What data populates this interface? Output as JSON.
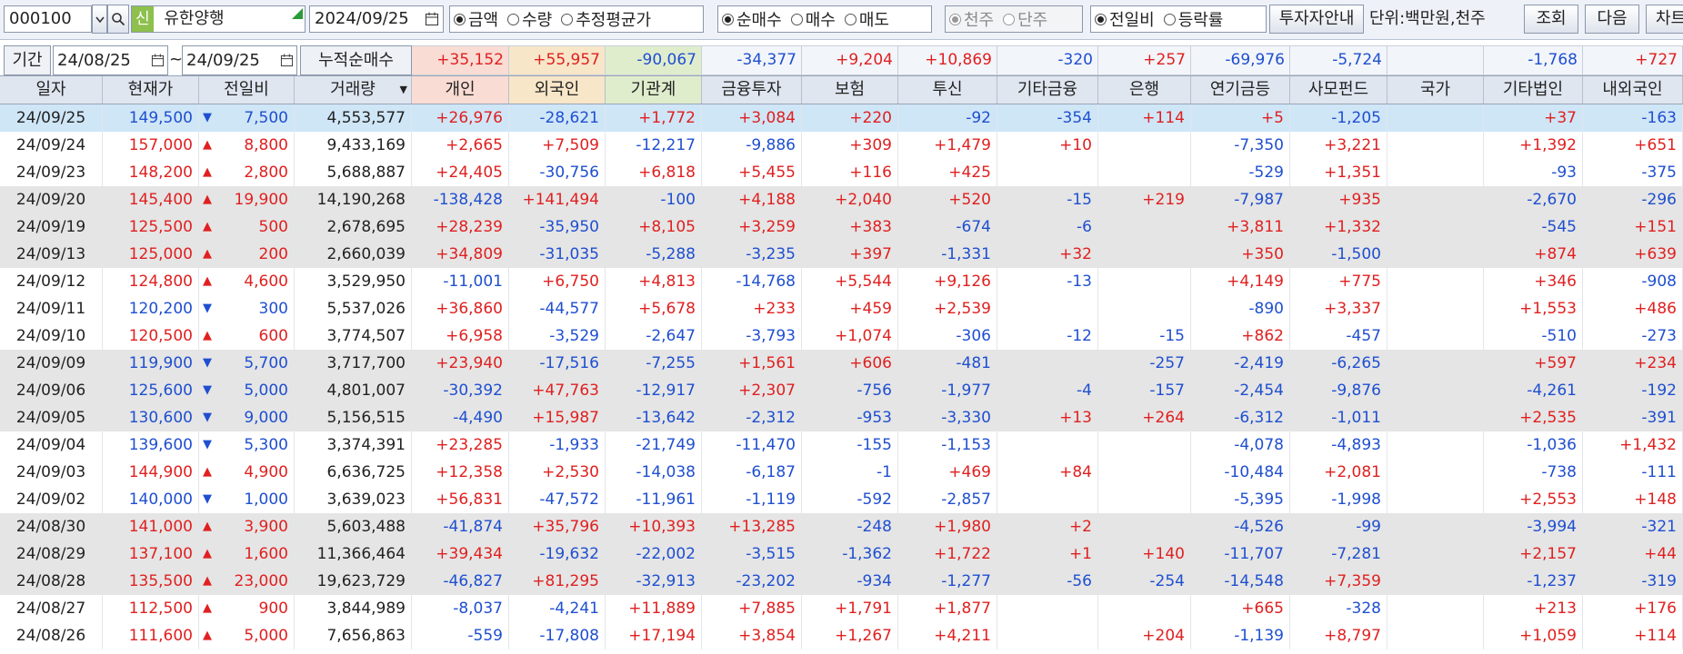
{
  "toolbar": {
    "code": "000100",
    "new_tag": "신",
    "stock_name": "유한양행",
    "date": "2024/09/25",
    "radio_value": [
      {
        "label": "금액",
        "checked": true
      },
      {
        "label": "수량",
        "checked": false
      },
      {
        "label": "추정평균가",
        "checked": false
      }
    ],
    "radio_type": [
      {
        "label": "순매수",
        "checked": true
      },
      {
        "label": "매수",
        "checked": false
      },
      {
        "label": "매도",
        "checked": false
      }
    ],
    "radio_unit": [
      {
        "label": "천주",
        "checked": true
      },
      {
        "label": "단주",
        "checked": false
      }
    ],
    "radio_compare": [
      {
        "label": "전일비",
        "checked": true
      },
      {
        "label": "등락률",
        "checked": false
      }
    ],
    "investor_guide_label": "투자자안내",
    "unit_text": "단위:백만원,천주",
    "query_label": "조회",
    "next_label": "다음",
    "chart_label": "차트"
  },
  "filter": {
    "period_label": "기간",
    "from_date": "24/08/25",
    "tilde": "~",
    "to_date": "24/09/25",
    "cumulative_label": "누적순매수",
    "sums": [
      "+35,152",
      "+55,957",
      "-90,067",
      "-34,377",
      "+9,204",
      "+10,869",
      "-320",
      "+257",
      "-69,976",
      "-5,724",
      "",
      "-1,768",
      "+727"
    ]
  },
  "columns": [
    "일자",
    "현재가",
    "전일비",
    "거래량",
    "개인",
    "외국인",
    "기관계",
    "금융투자",
    "보험",
    "투신",
    "기타금융",
    "은행",
    "연기금등",
    "사모펀드",
    "국가",
    "기타법인",
    "내외국인"
  ],
  "colors": {
    "up": "#e02020",
    "down": "#1f4fd0",
    "selected_row": "#cfe6f7",
    "shaded_row": "#e5e5e5",
    "personal_header": "#f9dcd3",
    "foreign_header": "#f7e6c8",
    "institution_header": "#e0edcd"
  },
  "rows": [
    [
      "24/09/25",
      "149,500",
      "▼",
      "7,500",
      "4,553,577",
      "+26,976",
      "-28,621",
      "+1,772",
      "+3,084",
      "+220",
      "-92",
      "-354",
      "+114",
      "+5",
      "-1,205",
      "",
      "+37",
      "-163"
    ],
    [
      "24/09/24",
      "157,000",
      "▲",
      "8,800",
      "9,433,169",
      "+2,665",
      "+7,509",
      "-12,217",
      "-9,886",
      "+309",
      "+1,479",
      "+10",
      "",
      "-7,350",
      "+3,221",
      "",
      "+1,392",
      "+651"
    ],
    [
      "24/09/23",
      "148,200",
      "▲",
      "2,800",
      "5,688,887",
      "+24,405",
      "-30,756",
      "+6,818",
      "+5,455",
      "+116",
      "+425",
      "",
      "",
      "-529",
      "+1,351",
      "",
      "-93",
      "-375"
    ],
    [
      "24/09/20",
      "145,400",
      "▲",
      "19,900",
      "14,190,268",
      "-138,428",
      "+141,494",
      "-100",
      "+4,188",
      "+2,040",
      "+520",
      "-15",
      "+219",
      "-7,987",
      "+935",
      "",
      "-2,670",
      "-296"
    ],
    [
      "24/09/19",
      "125,500",
      "▲",
      "500",
      "2,678,695",
      "+28,239",
      "-35,950",
      "+8,105",
      "+3,259",
      "+383",
      "-674",
      "-6",
      "",
      "+3,811",
      "+1,332",
      "",
      "-545",
      "+151"
    ],
    [
      "24/09/13",
      "125,000",
      "▲",
      "200",
      "2,660,039",
      "+34,809",
      "-31,035",
      "-5,288",
      "-3,235",
      "+397",
      "-1,331",
      "+32",
      "",
      "+350",
      "-1,500",
      "",
      "+874",
      "+639"
    ],
    [
      "24/09/12",
      "124,800",
      "▲",
      "4,600",
      "3,529,950",
      "-11,001",
      "+6,750",
      "+4,813",
      "-14,768",
      "+5,544",
      "+9,126",
      "-13",
      "",
      "+4,149",
      "+775",
      "",
      "+346",
      "-908"
    ],
    [
      "24/09/11",
      "120,200",
      "▼",
      "300",
      "5,537,026",
      "+36,860",
      "-44,577",
      "+5,678",
      "+233",
      "+459",
      "+2,539",
      "",
      "",
      "-890",
      "+3,337",
      "",
      "+1,553",
      "+486"
    ],
    [
      "24/09/10",
      "120,500",
      "▲",
      "600",
      "3,774,507",
      "+6,958",
      "-3,529",
      "-2,647",
      "-3,793",
      "+1,074",
      "-306",
      "-12",
      "-15",
      "+862",
      "-457",
      "",
      "-510",
      "-273"
    ],
    [
      "24/09/09",
      "119,900",
      "▼",
      "5,700",
      "3,717,700",
      "+23,940",
      "-17,516",
      "-7,255",
      "+1,561",
      "+606",
      "-481",
      "",
      "-257",
      "-2,419",
      "-6,265",
      "",
      "+597",
      "+234"
    ],
    [
      "24/09/06",
      "125,600",
      "▼",
      "5,000",
      "4,801,007",
      "-30,392",
      "+47,763",
      "-12,917",
      "+2,307",
      "-756",
      "-1,977",
      "-4",
      "-157",
      "-2,454",
      "-9,876",
      "",
      "-4,261",
      "-192"
    ],
    [
      "24/09/05",
      "130,600",
      "▼",
      "9,000",
      "5,156,515",
      "-4,490",
      "+15,987",
      "-13,642",
      "-2,312",
      "-953",
      "-3,330",
      "+13",
      "+264",
      "-6,312",
      "-1,011",
      "",
      "+2,535",
      "-391"
    ],
    [
      "24/09/04",
      "139,600",
      "▼",
      "5,300",
      "3,374,391",
      "+23,285",
      "-1,933",
      "-21,749",
      "-11,470",
      "-155",
      "-1,153",
      "",
      "",
      "-4,078",
      "-4,893",
      "",
      "-1,036",
      "+1,432"
    ],
    [
      "24/09/03",
      "144,900",
      "▲",
      "4,900",
      "6,636,725",
      "+12,358",
      "+2,530",
      "-14,038",
      "-6,187",
      "-1",
      "+469",
      "+84",
      "",
      "-10,484",
      "+2,081",
      "",
      "-738",
      "-111"
    ],
    [
      "24/09/02",
      "140,000",
      "▼",
      "1,000",
      "3,639,023",
      "+56,831",
      "-47,572",
      "-11,961",
      "-1,119",
      "-592",
      "-2,857",
      "",
      "",
      "-5,395",
      "-1,998",
      "",
      "+2,553",
      "+148"
    ],
    [
      "24/08/30",
      "141,000",
      "▲",
      "3,900",
      "5,603,488",
      "-41,874",
      "+35,796",
      "+10,393",
      "+13,285",
      "-248",
      "+1,980",
      "+2",
      "",
      "-4,526",
      "-99",
      "",
      "-3,994",
      "-321"
    ],
    [
      "24/08/29",
      "137,100",
      "▲",
      "1,600",
      "11,366,464",
      "+39,434",
      "-19,632",
      "-22,002",
      "-3,515",
      "-1,362",
      "+1,722",
      "+1",
      "+140",
      "-11,707",
      "-7,281",
      "",
      "+2,157",
      "+44"
    ],
    [
      "24/08/28",
      "135,500",
      "▲",
      "23,000",
      "19,623,729",
      "-46,827",
      "+81,295",
      "-32,913",
      "-23,202",
      "-934",
      "-1,277",
      "-56",
      "-254",
      "-14,548",
      "+7,359",
      "",
      "-1,237",
      "-319"
    ],
    [
      "24/08/27",
      "112,500",
      "▲",
      "900",
      "3,844,989",
      "-8,037",
      "-4,241",
      "+11,889",
      "+7,885",
      "+1,791",
      "+1,877",
      "",
      "",
      "+665",
      "-328",
      "",
      "+213",
      "+176"
    ],
    [
      "24/08/26",
      "111,600",
      "▲",
      "5,000",
      "7,656,863",
      "-559",
      "-17,808",
      "+17,194",
      "+3,854",
      "+1,267",
      "+4,211",
      "",
      "+204",
      "-1,139",
      "+8,797",
      "",
      "+1,059",
      "+114"
    ]
  ]
}
